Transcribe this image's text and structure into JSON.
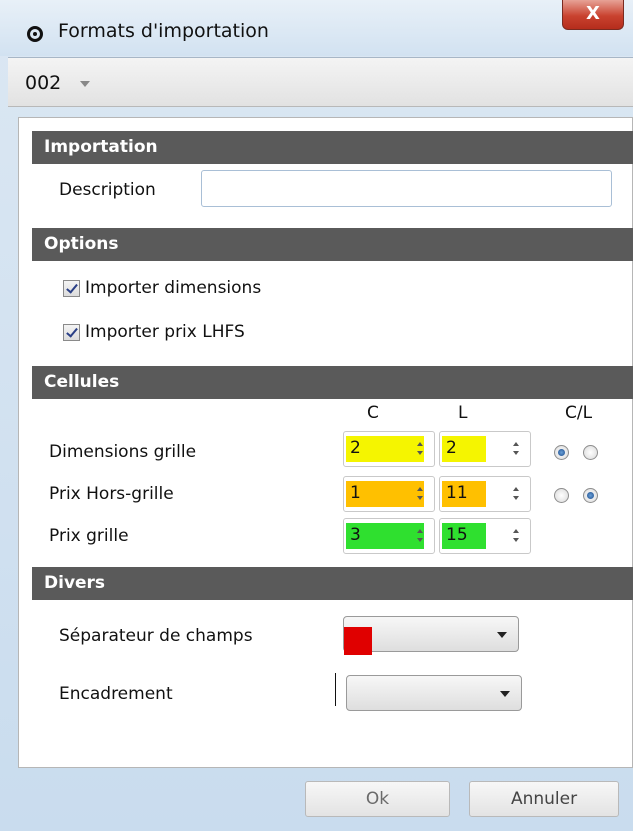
{
  "window": {
    "title": "Formats d'importation",
    "close_label": "X"
  },
  "toolbar": {
    "format_value": "002"
  },
  "importation": {
    "header": "Importation",
    "description_label": "Description",
    "description_value": ""
  },
  "options": {
    "header": "Options",
    "import_dimensions_label": "Importer dimensions",
    "import_dimensions_checked": true,
    "import_price_label": "Importer prix LHFS",
    "import_price_checked": true
  },
  "cellules": {
    "header": "Cellules",
    "col_c": "C",
    "col_l": "L",
    "col_cl": "C/L",
    "rows": [
      {
        "label": "Dimensions grille",
        "c": "2",
        "l": "2",
        "cl_selected": "C",
        "highlight": "#f5f500"
      },
      {
        "label": "Prix Hors-grille",
        "c": "1",
        "l": "11",
        "cl_selected": "L",
        "highlight": "#ffc000"
      },
      {
        "label": "Prix grille",
        "c": "3",
        "l": "15",
        "cl_selected": null,
        "highlight": "#2fe02f"
      }
    ]
  },
  "divers": {
    "header": "Divers",
    "separator_label": "Séparateur de champs",
    "separator_value": "",
    "separator_marker_color": "#e00000",
    "frame_label": "Encadrement",
    "frame_value": ""
  },
  "buttons": {
    "ok": "Ok",
    "cancel": "Annuler"
  },
  "colors": {
    "section_header": "#5a5a5a",
    "window_frame": "#c9dcee"
  },
  "icons": {
    "app": "radio-circle-icon",
    "close": "close-icon",
    "dropdown": "chevron-down-icon"
  }
}
